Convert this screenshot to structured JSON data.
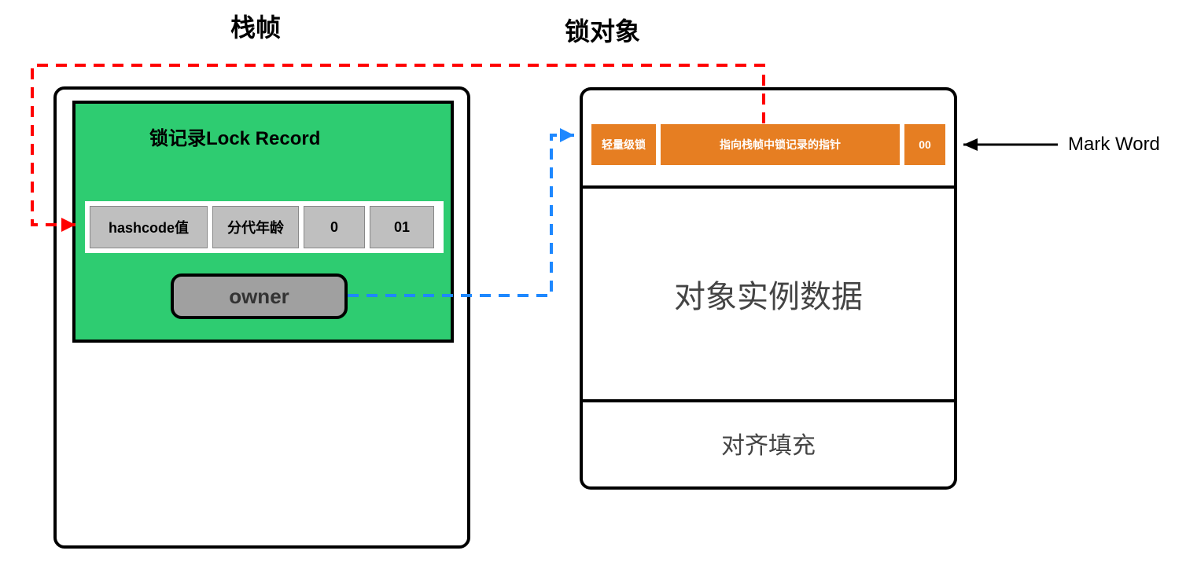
{
  "titles": {
    "stack_frame": "栈帧",
    "lock_object": "锁对象"
  },
  "lock_record": {
    "title": "锁记录Lock Record",
    "cells": {
      "hashcode": "hashcode值",
      "age": "分代年龄",
      "biased": "0",
      "flag": "01"
    },
    "owner": "owner"
  },
  "mark_word": {
    "lock_type": "轻量级锁",
    "pointer_desc": "指向栈帧中锁记录的指针",
    "flag": "00",
    "label": "Mark Word"
  },
  "object": {
    "instance_data": "对象实例数据",
    "padding": "对齐填充"
  }
}
